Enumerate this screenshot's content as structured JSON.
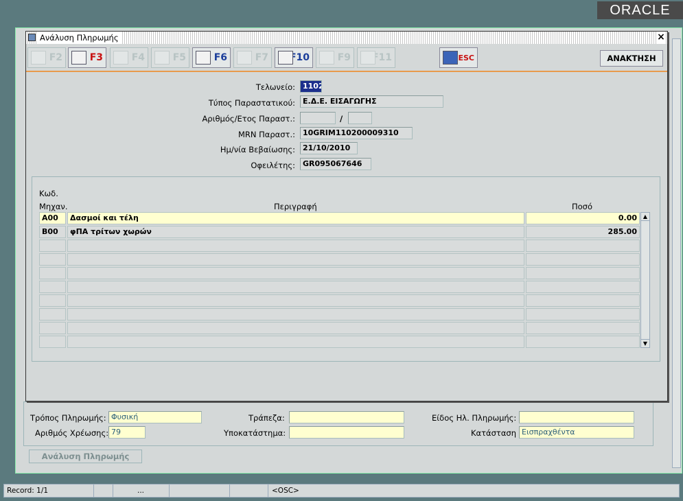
{
  "brand": "ORACLE",
  "dialog": {
    "title": "Ανάλυση Πληρωμής",
    "close_glyph": "×",
    "toolbar": [
      {
        "key": "F2",
        "enabled": false,
        "icon": "save-icon"
      },
      {
        "key": "F3",
        "enabled": true,
        "icon": "help-icon"
      },
      {
        "key": "F4",
        "enabled": false,
        "icon": "copy-icon"
      },
      {
        "key": "F5",
        "enabled": false,
        "icon": "delete-icon"
      },
      {
        "key": "F6",
        "enabled": true,
        "icon": "edit-document-icon"
      },
      {
        "key": "F7",
        "enabled": false,
        "icon": "zoom-icon"
      },
      {
        "key": "F10",
        "enabled": true,
        "icon": "print-icon"
      },
      {
        "key": "F9",
        "enabled": false,
        "icon": "add-record-icon"
      },
      {
        "key": "F11",
        "enabled": false,
        "icon": "remove-record-icon"
      },
      {
        "key": "ESC",
        "enabled": true,
        "icon": "exit-door-icon"
      }
    ],
    "search_button": "ΑΝΑΚΤΗΣΗ",
    "form": {
      "customs_label": "Τελωνείο:",
      "customs_value": "1102",
      "doc_type_label": "Τύπος Παραστατικού:",
      "doc_type_value": "Ε.Δ.Ε. ΕΙΣΑΓΩΓΗΣ",
      "doc_num_label": "Αριθμός/Ετος Παραστ.:",
      "doc_num_value": "",
      "doc_year_value": "",
      "separator": "/",
      "mrn_label": "MRN Παραστ.:",
      "mrn_value": "10GRIM110200009310",
      "date_label": "Ημ/νία Βεβαίωσης:",
      "date_value": "21/10/2010",
      "debtor_label": "Οφειλέτης:",
      "debtor_value": "GR095067646"
    },
    "table": {
      "col_code_line1": "Κωδ.",
      "col_code_line2": "Μηχαν.",
      "col_desc": "Περιγραφή",
      "col_amount": "Ποσό",
      "rows": [
        {
          "code": "A00",
          "desc": "Δασμοί και τέλη",
          "amount": "0.00"
        },
        {
          "code": "B00",
          "desc": "φΠΑ τρίτων χωρών",
          "amount": "285.00"
        },
        {
          "code": "",
          "desc": "",
          "amount": ""
        },
        {
          "code": "",
          "desc": "",
          "amount": ""
        },
        {
          "code": "",
          "desc": "",
          "amount": ""
        },
        {
          "code": "",
          "desc": "",
          "amount": ""
        },
        {
          "code": "",
          "desc": "",
          "amount": ""
        },
        {
          "code": "",
          "desc": "",
          "amount": ""
        },
        {
          "code": "",
          "desc": "",
          "amount": ""
        },
        {
          "code": "",
          "desc": "",
          "amount": ""
        }
      ]
    }
  },
  "background": {
    "payment_method_label": "Τρόπος Πληρωμής:",
    "payment_method_value": "Φυσική",
    "bank_label": "Τράπεζα:",
    "bank_value": "",
    "epay_type_label": "Είδος Ηλ. Πληρωμής:",
    "epay_type_value": "",
    "charge_num_label": "Αριθμός Χρέωσης:",
    "charge_num_value": "79",
    "branch_label": "Υποκατάστημα:",
    "branch_value": "",
    "status_label": "Κατάσταση",
    "status_value": "Εισπραχθέντα",
    "analysis_button": "Ανάλυση Πληρωμής"
  },
  "statusbar": {
    "record": "Record: 1/1",
    "ellipsis": "...",
    "mode": "<OSC>"
  },
  "colors": {
    "accent_line": "#e89a4c",
    "enabled_key": "#1a3d9a",
    "esc_key": "#c81212",
    "highlight_row": "#ffffd0"
  }
}
